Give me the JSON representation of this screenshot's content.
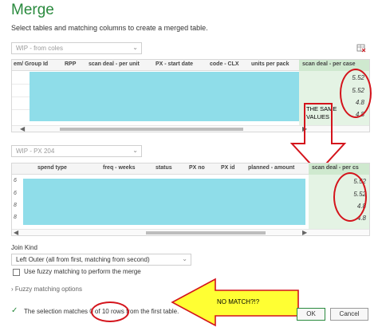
{
  "dialog": {
    "title": "Merge",
    "subtitle": "Select tables and matching columns to create a merged table."
  },
  "table1": {
    "source": "WIP - from coles",
    "columns": [
      "em/ Group Id",
      "RPP",
      "scan deal - per unit",
      "PX - start date",
      "code - CLX",
      "units per pack",
      "scan deal - per case"
    ],
    "values": [
      "5.52",
      "5.52",
      "4.8",
      "4.8"
    ]
  },
  "table2": {
    "source": "WIP - PX 204",
    "columns": [
      "spend type",
      "freq - weeks",
      "status",
      "PX no",
      "PX id",
      "planned - amount",
      "scan deal - per cs"
    ],
    "row_prefixes": [
      "6",
      "6",
      "8",
      "8"
    ],
    "values": [
      "5.52",
      "5.52",
      "4.8",
      "4.8"
    ]
  },
  "annotations": {
    "same_values": "THE SAME VALUES",
    "no_match": "NO MATCH?!?"
  },
  "join": {
    "label": "Join Kind",
    "selected": "Left Outer (all from first, matching from second)"
  },
  "fuzzy": {
    "checkbox_label": "Use fuzzy matching to perform the merge",
    "options_label": "Fuzzy matching options"
  },
  "status": {
    "message": "The selection matches 0 of 10 rows from the first table."
  },
  "buttons": {
    "ok": "OK",
    "cancel": "Cancel"
  },
  "colors": {
    "title_green": "#2a8a3e",
    "highlight_cyan": "#8fdde9",
    "match_col_green": "#e4f3e4",
    "annotation_red": "#d4141c",
    "arrow_yellow": "#ffff33",
    "check_green": "#2a8a3e"
  }
}
